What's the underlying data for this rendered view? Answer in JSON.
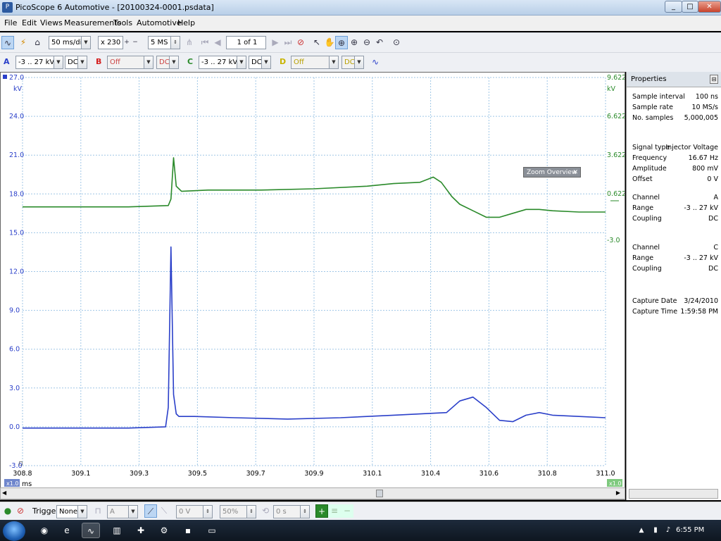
{
  "window": {
    "title": "PicoScope 6 Automotive - [20100324-0001.psdata]",
    "minimize": "_",
    "maximize": "□",
    "close": "✕"
  },
  "menu": [
    "File",
    "Edit",
    "Views",
    "Measurements",
    "Tools",
    "Automotive",
    "Help"
  ],
  "toolbar": {
    "timebase": "50 ms/div",
    "zoom": "x 230",
    "samples": "5 MS",
    "page": "1 of 1"
  },
  "channels": {
    "a": {
      "label": "A",
      "range": "-3 .. 27 kV",
      "coupling": "DC",
      "color": "#2a3fc9"
    },
    "b": {
      "label": "B",
      "range": "Off",
      "coupling": "DC",
      "color": "#d42020"
    },
    "c": {
      "label": "C",
      "range": "-3 .. 27 kV",
      "coupling": "DC",
      "color": "#2a8a2a"
    },
    "d": {
      "label": "D",
      "range": "Off",
      "coupling": "DC",
      "color": "#c8b400"
    }
  },
  "scope": {
    "zoom_overview": "Zoom Overview",
    "left_unit": "kV",
    "right_unit": "kV",
    "bottom_unit": "ms",
    "x1_left": "x1.0",
    "x1_right": "x1.0",
    "left_ticks": [
      "27.0",
      "24.0",
      "21.0",
      "18.0",
      "15.0",
      "12.0",
      "9.0",
      "6.0",
      "3.0",
      "0.0",
      "-3.0"
    ],
    "right_ticks": [
      "9.622",
      "6.622",
      "3.622",
      "0.622",
      "-3.0"
    ],
    "x_ticks": [
      "308.8",
      "309.1",
      "309.3",
      "309.5",
      "309.7",
      "309.9",
      "310.1",
      "310.4",
      "310.6",
      "310.8",
      "311.0"
    ]
  },
  "chart_data": {
    "type": "line",
    "xlabel": "ms",
    "ylabel": "kV",
    "x_range": [
      308.8,
      311.0
    ],
    "ylim": [
      -3.0,
      27.0
    ],
    "grid": true,
    "series": [
      {
        "name": "C",
        "color": "#2a8a2a",
        "x": [
          308.8,
          309.2,
          309.35,
          309.36,
          309.37,
          309.38,
          309.4,
          309.5,
          309.7,
          309.9,
          310.1,
          310.2,
          310.3,
          310.35,
          310.38,
          310.42,
          310.45,
          310.5,
          310.55,
          310.6,
          310.65,
          310.7,
          310.75,
          310.8,
          310.9,
          311.0
        ],
        "values": [
          17.0,
          17.0,
          17.1,
          17.6,
          20.8,
          18.6,
          18.2,
          18.3,
          18.3,
          18.4,
          18.6,
          18.8,
          18.9,
          19.3,
          18.9,
          17.8,
          17.2,
          16.7,
          16.2,
          16.2,
          16.5,
          16.8,
          16.8,
          16.7,
          16.6,
          16.6
        ]
      },
      {
        "name": "A",
        "color": "#2a3fc9",
        "x": [
          308.8,
          309.2,
          309.34,
          309.35,
          309.36,
          309.37,
          309.38,
          309.39,
          309.45,
          309.6,
          309.8,
          310.0,
          310.2,
          310.4,
          310.45,
          310.5,
          310.55,
          310.6,
          310.65,
          310.7,
          310.75,
          310.8,
          310.9,
          311.0
        ],
        "values": [
          -0.1,
          -0.1,
          0.0,
          1.5,
          13.9,
          2.5,
          1.0,
          0.8,
          0.8,
          0.7,
          0.6,
          0.7,
          0.9,
          1.1,
          2.0,
          2.3,
          1.5,
          0.5,
          0.4,
          0.9,
          1.1,
          0.9,
          0.8,
          0.7
        ]
      }
    ]
  },
  "properties": {
    "title": "Properties",
    "rows": [
      {
        "k": "Sample interval",
        "v": "100 ns"
      },
      {
        "k": "Sample rate",
        "v": "10 MS/s"
      },
      {
        "k": "No. samples",
        "v": "5,000,005"
      },
      {
        "k": "Signal type",
        "v": "Injector Voltage"
      },
      {
        "k": "Frequency",
        "v": "16.67 Hz"
      },
      {
        "k": "Amplitude",
        "v": "800 mV"
      },
      {
        "k": "Offset",
        "v": "0 V"
      },
      {
        "k": "Channel",
        "v": "A"
      },
      {
        "k": "Range",
        "v": "-3 .. 27 kV"
      },
      {
        "k": "Coupling",
        "v": "DC"
      },
      {
        "k": "Channel",
        "v": "C"
      },
      {
        "k": "Range",
        "v": "-3 .. 27 kV"
      },
      {
        "k": "Coupling",
        "v": "DC"
      },
      {
        "k": "Capture Date",
        "v": "3/24/2010"
      },
      {
        "k": "Capture Time",
        "v": "1:59:58 PM"
      }
    ]
  },
  "bottom": {
    "trigger_label": "Trigger",
    "trigger_mode": "None",
    "trigger_channel": "A",
    "trigger_level": "0 V",
    "pre_trigger": "50%",
    "delay": "0 s"
  },
  "taskbar": {
    "clock": "6:55 PM"
  }
}
